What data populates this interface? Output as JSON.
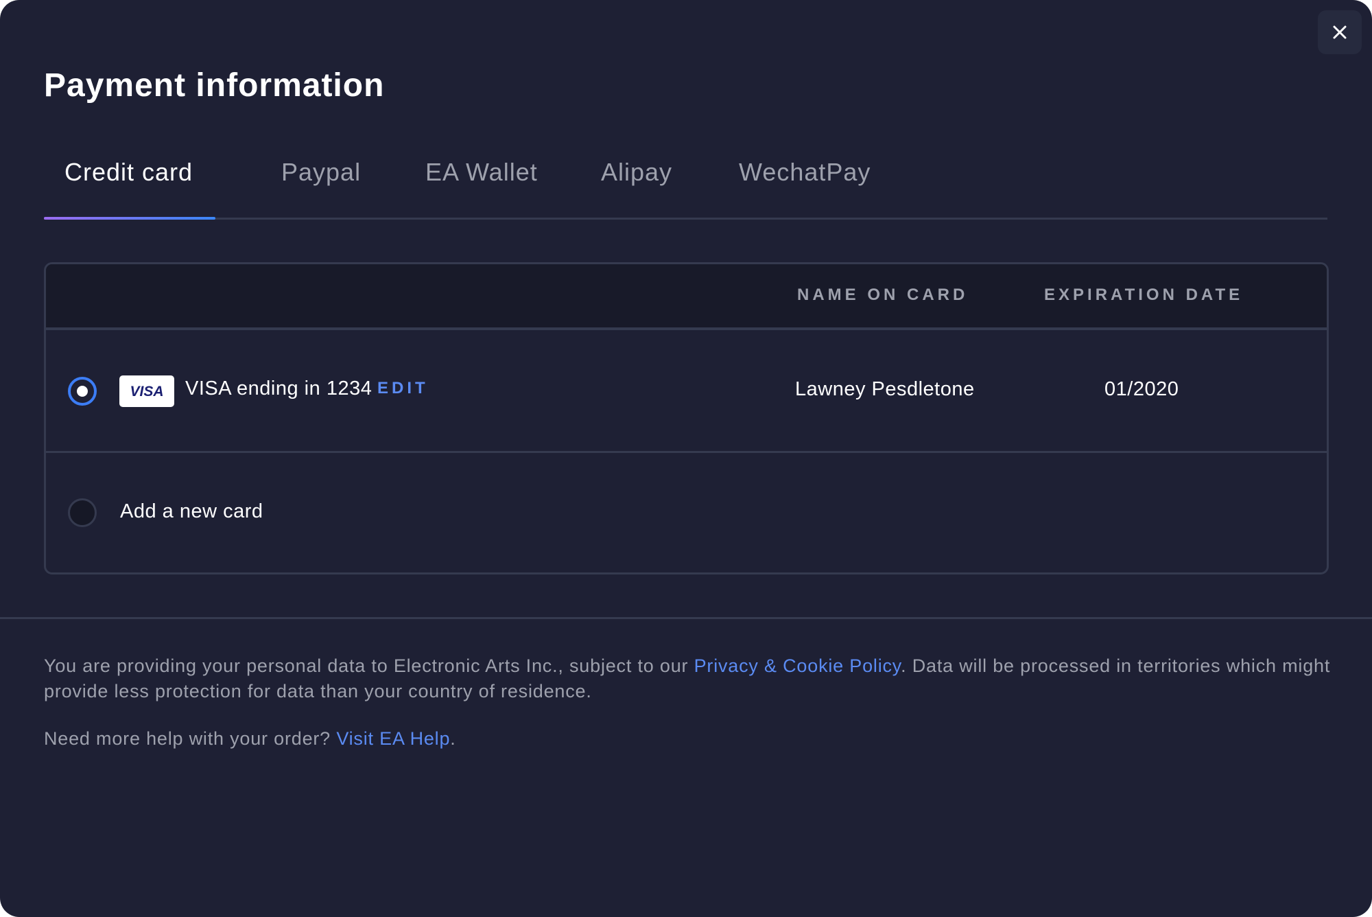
{
  "modal": {
    "title": "Payment information",
    "close_icon": "close-icon"
  },
  "tabs": [
    {
      "label": "Credit card",
      "active": true
    },
    {
      "label": "Paypal",
      "active": false
    },
    {
      "label": "EA Wallet",
      "active": false
    },
    {
      "label": "Alipay",
      "active": false
    },
    {
      "label": "WechatPay",
      "active": false
    }
  ],
  "table": {
    "headers": {
      "name_on_card": "NAME ON CARD",
      "expiration_date": "EXPIRATION DATE"
    },
    "cards": [
      {
        "selected": true,
        "brand": "VISA",
        "label": "VISA ending in 1234",
        "edit_label": "EDIT",
        "name_on_card": "Lawney Pesdletone",
        "expiration": "01/2020"
      }
    ],
    "add_card_label": "Add a new card"
  },
  "footer": {
    "privacy_prefix": "You are providing your personal data to Electronic Arts Inc., subject to our ",
    "privacy_link": "Privacy & Cookie Policy",
    "privacy_suffix": ". Data will be processed in territories which might provide less protection for data than your country of residence.",
    "help_prefix": "Need more help with your order? ",
    "help_link": "Visit EA Help",
    "help_suffix": "."
  },
  "colors": {
    "background": "#1e2034",
    "accent": "#3c7df5",
    "link": "#5b8bf2",
    "muted_text": "#9ea1ad",
    "border": "#353a4f"
  }
}
